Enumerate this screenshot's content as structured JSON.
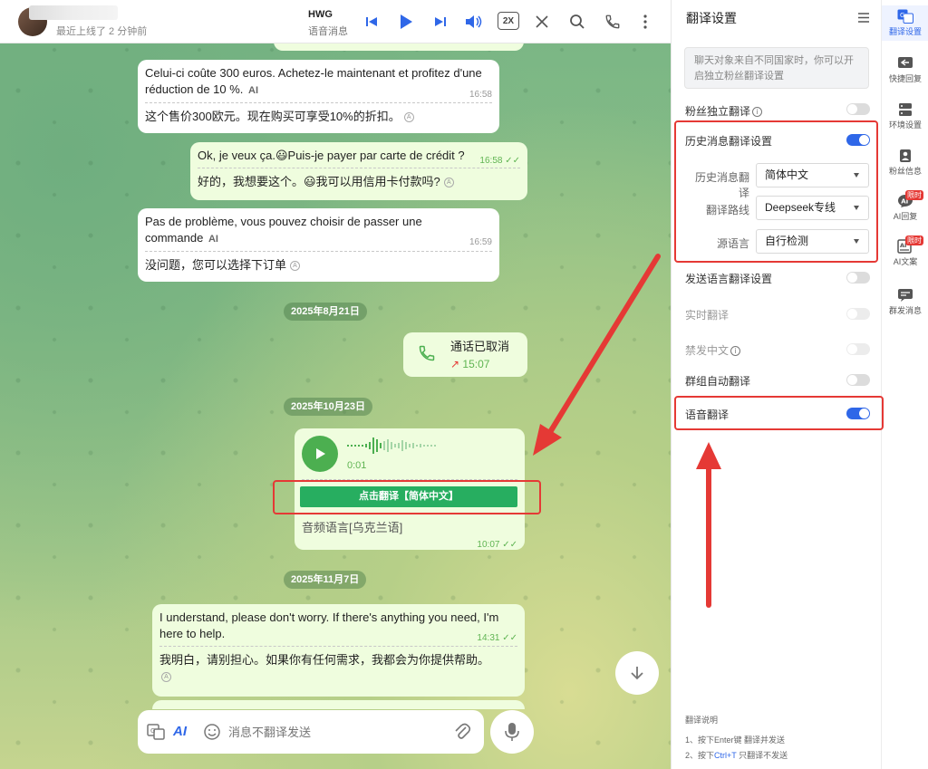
{
  "header": {
    "last_seen": "最近上线了 2 分钟前",
    "voice_title": "HWG",
    "voice_subtitle": "语音消息",
    "speed": "2X"
  },
  "messages": {
    "m1": {
      "text": "Celui-ci coûte 300 euros. Achetez-le maintenant et profitez d'une réduction de 10 %.",
      "ai": "AI",
      "time": "16:58",
      "translation": "这个售价300欧元。现在购买可享受10%的折扣。"
    },
    "m2": {
      "text": "Ok, je veux ça.😃Puis-je payer par carte de crédit ?",
      "time": "16:58",
      "translation": "好的，我想要这个。😃我可以用信用卡付款吗?"
    },
    "m3": {
      "text": "Pas de problème, vous pouvez choisir de passer une commande",
      "ai": "AI",
      "time": "16:59",
      "translation": "没问题，您可以选择下订单"
    },
    "date1": "2025年8月21日",
    "call": {
      "label": "通话已取消",
      "time": "15:07"
    },
    "date2": "2025年10月23日",
    "voice": {
      "duration": "0:01",
      "translate_button": "点击翻译【简体中文】",
      "lang_label": "音频语言[乌克兰语]",
      "time": "10:07"
    },
    "date3": "2025年11月7日",
    "m4": {
      "text": "I understand, please don't worry. If there's anything you need, I'm here to help.",
      "time": "14:31",
      "translation": "我明白，请别担心。如果你有任何需求，我都会为你提供帮助。"
    }
  },
  "input": {
    "placeholder": "消息不翻译发送",
    "ai_label": "AI"
  },
  "panel": {
    "title": "翻译设置",
    "notice": "聊天对象来自不同国家时，你可以开启独立粉丝翻译设置",
    "fan_independent": {
      "label": "粉丝独立翻译",
      "on": false
    },
    "history": {
      "label": "历史消息翻译设置",
      "on": true,
      "fields": [
        {
          "label": "历史消息翻译",
          "value": "简体中文"
        },
        {
          "label": "翻译路线",
          "value": "Deepseek专线"
        },
        {
          "label": "源语言",
          "value": "自行检测"
        }
      ]
    },
    "send_lang": {
      "label": "发送语言翻译设置",
      "on": false
    },
    "realtime": {
      "label": "实时翻译",
      "on": false
    },
    "ban_chinese": {
      "label": "禁发中文",
      "on": false
    },
    "group_auto": {
      "label": "群组自动翻译",
      "on": false
    },
    "voice": {
      "label": "语音翻译",
      "on": true
    },
    "notes_title": "翻译说明",
    "note1_pre": "1、按下",
    "note1_key": "Enter键",
    "note1_post": " 翻译并发送",
    "note2_pre": "2、按下",
    "note2_key": "Ctrl+T",
    "note2_post": " 只翻译不发送"
  },
  "sidebar": {
    "items": [
      {
        "label": "翻译设置"
      },
      {
        "label": "快捷回复"
      },
      {
        "label": "环境设置"
      },
      {
        "label": "粉丝信息"
      },
      {
        "label": "AI回复",
        "badge": "限时"
      },
      {
        "label": "AI文案",
        "badge": "限时"
      },
      {
        "label": "群发消息"
      }
    ]
  },
  "colors": {
    "accent": "#2f67e8",
    "green_button": "#27ae60",
    "annotation": "#e53935",
    "out_bubble": "#effdde"
  }
}
